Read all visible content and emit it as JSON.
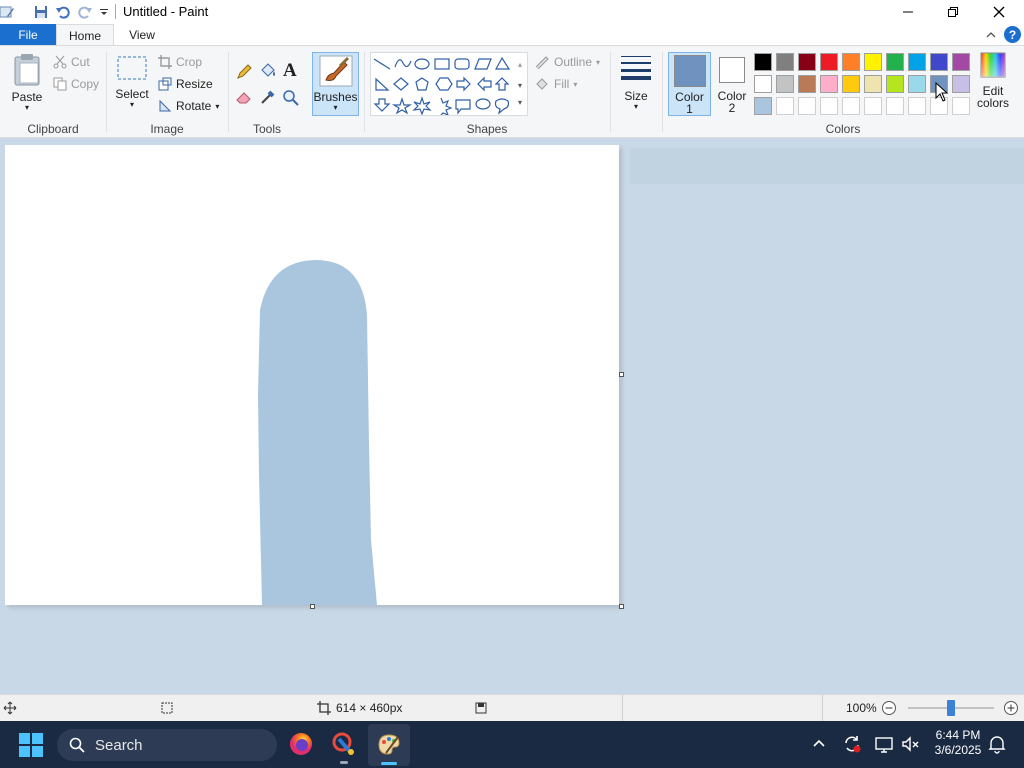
{
  "window": {
    "title": "Untitled - Paint"
  },
  "tabs": {
    "file": "File",
    "home": "Home",
    "view": "View"
  },
  "clipboard": {
    "paste": "Paste",
    "cut": "Cut",
    "copy": "Copy",
    "group": "Clipboard"
  },
  "image": {
    "select": "Select",
    "crop": "Crop",
    "resize": "Resize",
    "rotate": "Rotate",
    "group": "Image"
  },
  "tools": {
    "group": "Tools"
  },
  "brushes": {
    "label": "Brushes"
  },
  "shapes": {
    "outline": "Outline",
    "fill": "Fill",
    "group": "Shapes"
  },
  "size": {
    "label": "Size"
  },
  "colors": {
    "color1_label": "Color",
    "color1_num": "1",
    "color2_label": "Color",
    "color2_num": "2",
    "color1_value": "#7092be",
    "color2_value": "#ffffff",
    "edit_label_1": "Edit",
    "edit_label_2": "colors",
    "group": "Colors",
    "palette_row1": [
      "#000000",
      "#7f7f7f",
      "#880015",
      "#ed1c24",
      "#ff7f27",
      "#fff200",
      "#22b14c",
      "#00a2e8",
      "#3f48cc",
      "#a349a4"
    ],
    "palette_row2": [
      "#ffffff",
      "#c3c3c3",
      "#b97a57",
      "#ffaec9",
      "#ffc90e",
      "#efe4b0",
      "#b5e61d",
      "#99d9ea",
      "#7092be",
      "#c8bfe7"
    ],
    "palette_row3": [
      "#a9c6de",
      "#ffffff",
      "#ffffff",
      "#ffffff",
      "#ffffff",
      "#ffffff",
      "#ffffff",
      "#ffffff",
      "#ffffff",
      "#ffffff"
    ]
  },
  "statusbar": {
    "dimensions": "614 × 460px",
    "zoom": "100%",
    "zoom_level": 0.5
  },
  "taskbar": {
    "search": "Search",
    "time": "6:44 PM",
    "date": "3/6/2025"
  },
  "canvas": {
    "stroke_color": "#a9c6de"
  }
}
